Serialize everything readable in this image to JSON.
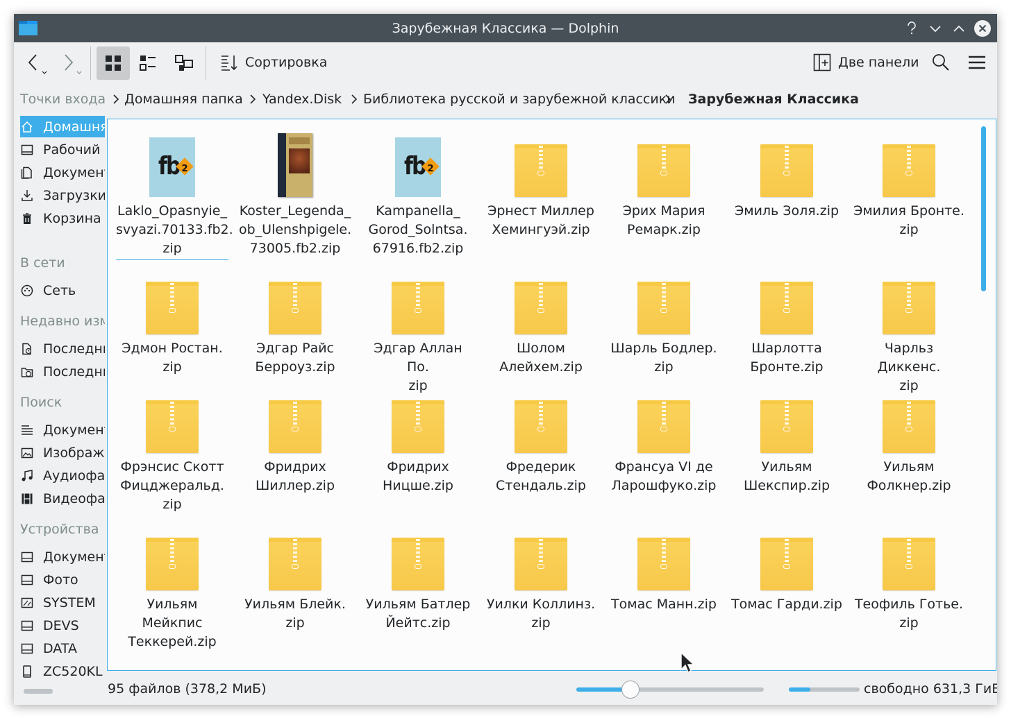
{
  "window": {
    "title": "Зарубежная Классика — Dolphin"
  },
  "toolbar": {
    "sort_label": "Сортировка",
    "split_label": "Две панели"
  },
  "breadcrumb": {
    "places": "Точки входа",
    "home": "Домашняя папка",
    "yandex": "Yandex.Disk",
    "library": "Библиотека русской и зарубежной классики",
    "current": "Зарубежная Классика"
  },
  "sidebar": {
    "places": [
      {
        "label": "Домашняя папка",
        "icon": "home-icon"
      },
      {
        "label": "Рабочий стол",
        "icon": "desktop-icon"
      },
      {
        "label": "Документы",
        "icon": "documents-icon"
      },
      {
        "label": "Загрузки",
        "icon": "downloads-icon"
      },
      {
        "label": "Корзина",
        "icon": "trash-icon"
      }
    ],
    "network_head": "В сети",
    "network": [
      {
        "label": "Сеть",
        "icon": "network-icon"
      }
    ],
    "recent_head": "Недавно изменённые",
    "recent": [
      {
        "label": "Последние файлы",
        "icon": "recent-files-icon"
      },
      {
        "label": "Последние места",
        "icon": "recent-places-icon"
      }
    ],
    "search_head": "Поиск",
    "search": [
      {
        "label": "Документы",
        "icon": "text-document-icon"
      },
      {
        "label": "Изображения",
        "icon": "image-icon"
      },
      {
        "label": "Аудиофайлы",
        "icon": "audio-icon"
      },
      {
        "label": "Видеофайлы",
        "icon": "video-icon"
      }
    ],
    "devices_head": "Устройства",
    "devices": [
      {
        "label": "Документы",
        "icon": "drive-icon"
      },
      {
        "label": "Фото",
        "icon": "drive-icon"
      },
      {
        "label": "SYSTEM",
        "icon": "drive-icon"
      },
      {
        "label": "DEVS",
        "icon": "drive-icon"
      },
      {
        "label": "DATA",
        "icon": "drive-icon"
      },
      {
        "label": "ZC520KL",
        "icon": "phone-icon"
      }
    ]
  },
  "files": [
    {
      "lines": [
        "Laklo_Opasnyie_",
        "svyazi.70133.fb2.",
        "zip"
      ],
      "kind": "fb2",
      "selected": true
    },
    {
      "lines": [
        "Koster_Legenda_",
        "ob_Ulenshpigele.",
        "73005.fb2.zip"
      ],
      "kind": "book"
    },
    {
      "lines": [
        "Kampanella_",
        "Gorod_Solntsa.",
        "67916.fb2.zip"
      ],
      "kind": "fb2"
    },
    {
      "lines": [
        "Эрнест Миллер",
        "Хемингуэй.zip"
      ],
      "kind": "zip"
    },
    {
      "lines": [
        "Эрих Мария",
        "Ремарк.zip"
      ],
      "kind": "zip"
    },
    {
      "lines": [
        "Эмиль Золя.zip"
      ],
      "kind": "zip"
    },
    {
      "lines": [
        "Эмилия Бронте.",
        "zip"
      ],
      "kind": "zip"
    },
    {
      "lines": [
        "Эдмон Ростан.",
        "zip"
      ],
      "kind": "zip"
    },
    {
      "lines": [
        "Эдгар Райс",
        "Берроуз.zip"
      ],
      "kind": "zip"
    },
    {
      "lines": [
        "Эдгар Аллан По.",
        "zip"
      ],
      "kind": "zip"
    },
    {
      "lines": [
        "Шолом",
        "Алейхем.zip"
      ],
      "kind": "zip"
    },
    {
      "lines": [
        "Шарль Бодлер.",
        "zip"
      ],
      "kind": "zip"
    },
    {
      "lines": [
        "Шарлотта",
        "Бронте.zip"
      ],
      "kind": "zip"
    },
    {
      "lines": [
        "Чарльз Диккенс.",
        "zip"
      ],
      "kind": "zip"
    },
    {
      "lines": [
        "Фрэнсис Скотт",
        "Фицджеральд.",
        "zip"
      ],
      "kind": "zip"
    },
    {
      "lines": [
        "Фридрих",
        "Шиллер.zip"
      ],
      "kind": "zip"
    },
    {
      "lines": [
        "Фридрих",
        "Ницше.zip"
      ],
      "kind": "zip"
    },
    {
      "lines": [
        "Фредерик",
        "Стендаль.zip"
      ],
      "kind": "zip"
    },
    {
      "lines": [
        "Франсуа VI де",
        "Ларошфуко.zip"
      ],
      "kind": "zip"
    },
    {
      "lines": [
        "Уильям",
        "Шекспир.zip"
      ],
      "kind": "zip"
    },
    {
      "lines": [
        "Уильям",
        "Фолкнер.zip"
      ],
      "kind": "zip"
    },
    {
      "lines": [
        "Уильям",
        "Мейкпис",
        "Теккерей.zip"
      ],
      "kind": "zip"
    },
    {
      "lines": [
        "Уильям Блейк.",
        "zip"
      ],
      "kind": "zip"
    },
    {
      "lines": [
        "Уильям Батлер",
        "Йейтс.zip"
      ],
      "kind": "zip"
    },
    {
      "lines": [
        "Уилки Коллинз.",
        "zip"
      ],
      "kind": "zip"
    },
    {
      "lines": [
        "Томас Манн.zip"
      ],
      "kind": "zip"
    },
    {
      "lines": [
        "Томас Гарди.zip"
      ],
      "kind": "zip"
    },
    {
      "lines": [
        "Теофиль Готье.",
        "zip"
      ],
      "kind": "zip"
    }
  ],
  "status": {
    "summary": "95 файлов (378,2 МиБ)",
    "free": "свободно 631,3 ГиБ",
    "zoom_fraction": 0.29,
    "used_fraction": 0.3
  },
  "colors": {
    "accent": "#3daee9",
    "titlebar": "#475057",
    "zip": "#f7c84a"
  }
}
